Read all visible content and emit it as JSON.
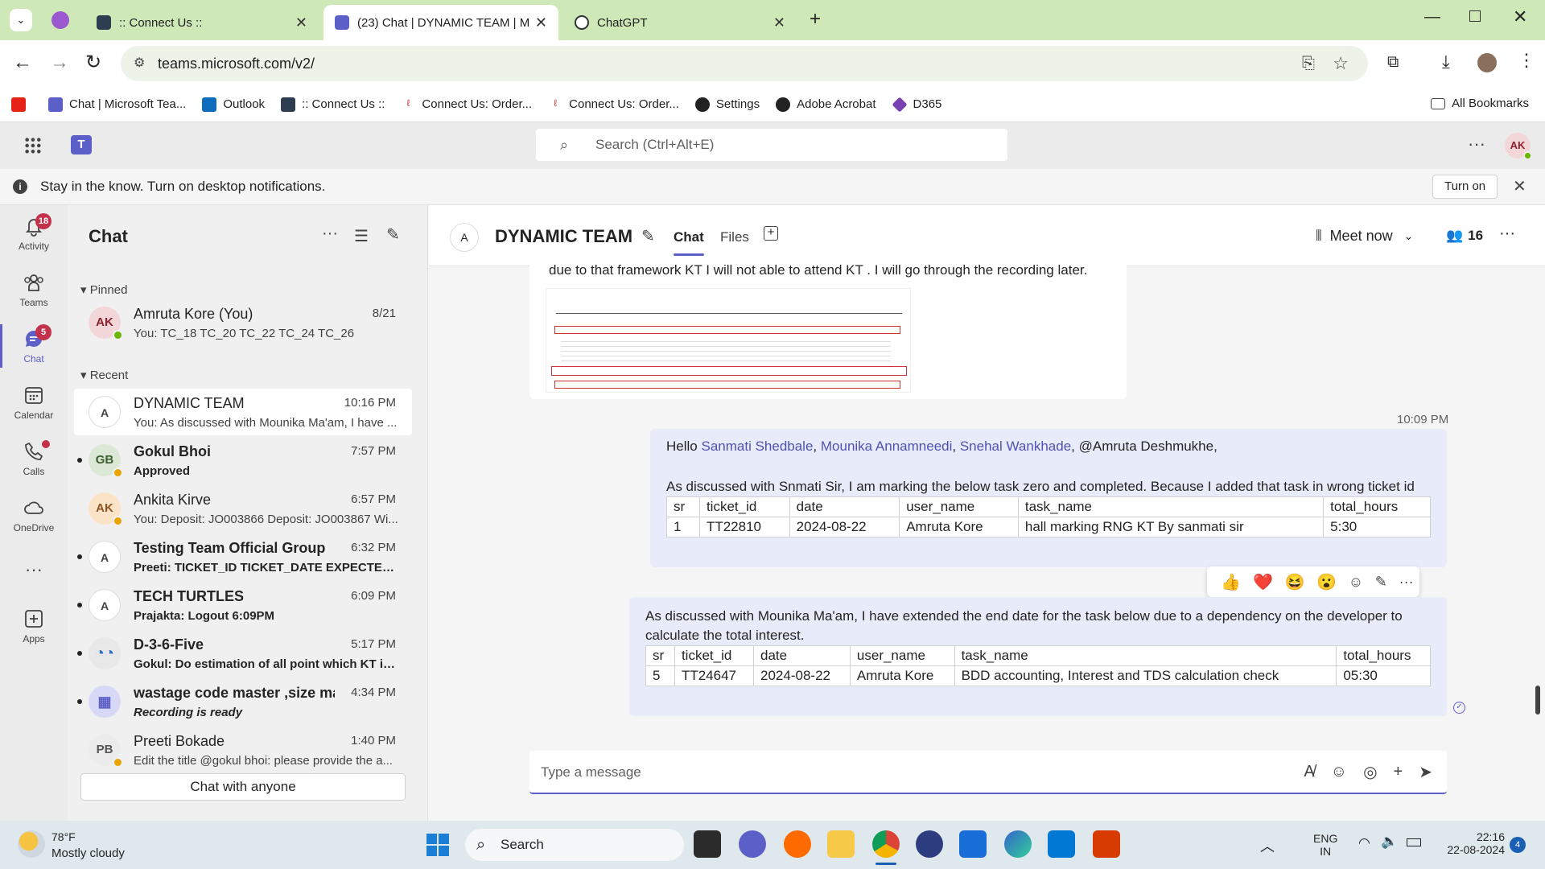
{
  "browser": {
    "tabs": [
      {
        "title": ":: Connect Us ::",
        "active": false
      },
      {
        "title": "(23) Chat | DYNAMIC TEAM | M",
        "active": true
      },
      {
        "title": "ChatGPT",
        "active": false
      }
    ],
    "url": "teams.microsoft.com/v2/",
    "bookmarks": [
      {
        "label": ""
      },
      {
        "label": "Chat | Microsoft Tea..."
      },
      {
        "label": "Outlook"
      },
      {
        "label": ":: Connect Us ::"
      },
      {
        "label": "Connect Us: Order..."
      },
      {
        "label": "Connect Us: Order..."
      },
      {
        "label": "Settings"
      },
      {
        "label": "Adobe Acrobat"
      },
      {
        "label": "D365"
      }
    ],
    "all_bookmarks": "All Bookmarks"
  },
  "teams": {
    "search_placeholder": "Search (Ctrl+Alt+E)",
    "user_initials": "AK",
    "notification": {
      "text": "Stay in the know. Turn on desktop notifications.",
      "button": "Turn on"
    },
    "rail": [
      {
        "label": "Activity",
        "badge": "18"
      },
      {
        "label": "Teams",
        "badge": ""
      },
      {
        "label": "Chat",
        "badge": "5"
      },
      {
        "label": "Calendar",
        "badge": ""
      },
      {
        "label": "Calls",
        "badge": ""
      },
      {
        "label": "OneDrive",
        "badge": ""
      },
      {
        "label": "",
        "badge": ""
      },
      {
        "label": "Apps",
        "badge": ""
      }
    ]
  },
  "chatlist": {
    "title": "Chat",
    "pinned_label": "Pinned",
    "recent_label": "Recent",
    "pinned": [
      {
        "initials": "AK",
        "name": "Amruta Kore (You)",
        "time": "8/21",
        "preview": "You: TC_18 TC_20 TC_22 TC_24 TC_26"
      }
    ],
    "recent": [
      {
        "initials": "A",
        "name": "DYNAMIC TEAM",
        "time": "10:16 PM",
        "preview": "You: As discussed with Mounika Ma'am, I have ..."
      },
      {
        "initials": "GB",
        "name": "Gokul Bhoi",
        "time": "7:57 PM",
        "preview": "Approved"
      },
      {
        "initials": "AK",
        "name": "Ankita Kirve",
        "time": "6:57 PM",
        "preview": "You: Deposit: JO003866 Deposit: JO003867   Wi..."
      },
      {
        "initials": "A",
        "name": "Testing Team Official Group",
        "time": "6:32 PM",
        "preview": "Preeti: TICKET_ID TICKET_DATE EXPECTED_SO..."
      },
      {
        "initials": "A",
        "name": "TECH TURTLES",
        "time": "6:09 PM",
        "preview": "Prajakta: Logout 6:09PM"
      },
      {
        "initials": "",
        "name": "D-3-6-Five",
        "time": "5:17 PM",
        "preview": "Gokul: Do estimation of all point which KT is ..."
      },
      {
        "initials": "",
        "name": "wastage code master ,size ma...",
        "time": "4:34 PM",
        "preview": "Recording is ready"
      },
      {
        "initials": "PB",
        "name": "Preeti Bokade",
        "time": "1:40 PM",
        "preview": "Edit the title @gokul bhoi: please provide the a..."
      }
    ],
    "chat_with_anyone": "Chat with anyone"
  },
  "conversation": {
    "title": "DYNAMIC TEAM",
    "tabs": [
      "Chat",
      "Files"
    ],
    "meet_now": "Meet now",
    "participants": "16",
    "prev_message_text": "due to that framework KT I will not able to attend KT . I will go through the recording later.",
    "msg1": {
      "time": "10:09 PM",
      "greeting": "Hello",
      "mentions": [
        "Sanmati Shedbale",
        "Mounika Annamneedi",
        "Snehal Wankhade"
      ],
      "mention_plain": ", @Amruta Deshmukhe,",
      "body": "As discussed with Snmati Sir, I am marking the below task zero and completed. Because I added that task in wrong ticket id",
      "table_headers": [
        "sr",
        "ticket_id",
        "date",
        "user_name",
        "task_name",
        "total_hours"
      ],
      "table_rows": [
        [
          "1",
          "TT22810",
          "2024-08-22",
          "Amruta Kore",
          "hall marking RNG KT By sanmati sir",
          "5:30"
        ]
      ]
    },
    "msg2": {
      "body": "As discussed with Mounika Ma'am, I have extended the end date for the task below due to a dependency on the developer to calculate the total interest.",
      "table_headers": [
        "sr",
        "ticket_id",
        "date",
        "user_name",
        "task_name",
        "total_hours"
      ],
      "table_rows": [
        [
          "5",
          "TT24647",
          "2024-08-22",
          "Amruta Kore",
          "BDD accounting, Interest and TDS calculation check",
          "05:30"
        ]
      ]
    },
    "reactions": [
      "👍",
      "❤️",
      "😆",
      "😮"
    ],
    "composer_placeholder": "Type a message"
  },
  "taskbar": {
    "weather_temp": "78°F",
    "weather_desc": "Mostly cloudy",
    "search": "Search",
    "lang1": "ENG",
    "lang2": "IN",
    "time": "22:16",
    "date": "22-08-2024",
    "notif_count": "4"
  }
}
